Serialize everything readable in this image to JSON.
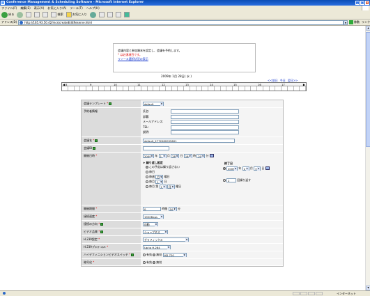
{
  "window": {
    "title": "Conference Management & Scheduling Software - Microsoft Internet Explorer"
  },
  "menu": [
    "ファイル(F)",
    "編集(E)",
    "表示(V)",
    "お気に入り(A)",
    "ツール(T)",
    "ヘルプ(H)"
  ],
  "toolbar": {
    "back": "戻る",
    "search": "検索",
    "favorites": "お気に入り"
  },
  "address": {
    "label": "アドレス(D)",
    "url": "http://165.93.50.42/mcs/createEditReserve.html",
    "go": "移動",
    "links": "リンク"
  },
  "info": {
    "line1": "会議内容と参加端末を設定し、会議を予約します。",
    "line2": "* は必須項目です。",
    "line3": "リソース選択状況の表示"
  },
  "timeline": {
    "date": "2009年 1月 28日( 水 )",
    "prev": "<<前日",
    "today": "今日",
    "next": "翌日>>",
    "hours": [
      "8",
      "9",
      "10",
      "11",
      "12",
      "13",
      "14",
      "15",
      "16",
      "17"
    ]
  },
  "form": {
    "template_label": "会議テンプレート",
    "template_value": "default",
    "booker_label": "予約者情報",
    "booker_fields": [
      "氏名:",
      "部署:",
      "メールアドレス:",
      "TEL:",
      "説明:"
    ],
    "name_label": "会議名",
    "name_value": "default_2772082055601",
    "id_label": "会議ID",
    "start_label": "開催日時",
    "start": {
      "year": "2009",
      "year_unit": "年",
      "month": "1",
      "month_unit": "月",
      "day": "28",
      "day_unit": "日",
      "hour": "16",
      "hour_unit": "時",
      "min": "20",
      "min_unit": "分"
    },
    "repeat_title": "➤ 繰り返し設定",
    "repeat_none": "この予定は繰り返さない",
    "repeat_daily": "毎日",
    "repeat_weekly": "毎週",
    "repeat_weekly_day": "月",
    "repeat_weekly_suffix": "曜日",
    "repeat_monthly": "毎月",
    "repeat_monthly_day": "1",
    "repeat_monthly_suffix": "日",
    "repeat_nth": "毎月 第",
    "repeat_nth_week": "1",
    "repeat_nth_day": "月",
    "repeat_nth_suffix": "曜日",
    "end_title": "終了日",
    "end": {
      "year": "2009",
      "year_unit": "年",
      "month": "2",
      "month_unit": "月",
      "day": "3",
      "day_unit": "日"
    },
    "end_count": "2",
    "end_count_suffix": "回繰り返す",
    "duration_label": "開催期間",
    "duration_hours": "0",
    "duration_hours_unit": "時間",
    "duration_min": "10",
    "duration_min_unit": "分",
    "speed_label": "接続速度",
    "speed_value": "1920Kbps",
    "direction_label": "接続の方向",
    "direction_value": "自動",
    "video_quality_label": "ビデオ品質",
    "video_quality_value": "シャープネス",
    "h239_label": "H.239設定",
    "h239_value": "グラフィックス",
    "h239_proto_label": "H.239プロトコル",
    "h239_proto_value": "Up to H.264",
    "hd_switch_label": "ハイデフィニションビデオスイッチ",
    "hd_on": "有効",
    "hd_off": "無効",
    "hd_value": "HD 720",
    "encryption_label": "暗号化",
    "enc_on": "有効",
    "enc_off": "無効"
  },
  "status": {
    "zone": "インターネット"
  }
}
